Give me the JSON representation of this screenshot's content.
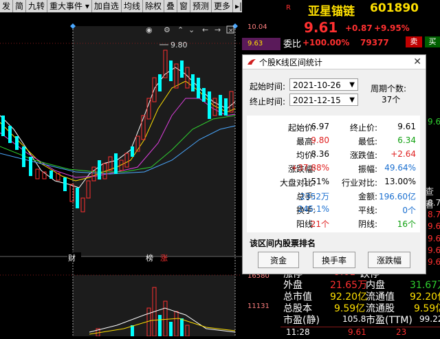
{
  "toolbar": {
    "items": [
      "发",
      "简",
      "九转",
      "重大事件",
      "加自选",
      "均线",
      "除权",
      "叠",
      "窗",
      "预测",
      "更多"
    ]
  },
  "chart": {
    "high_label": "9.80",
    "markers": [
      "财",
      "榜",
      "涨"
    ],
    "left_axis": [
      "10.04",
      "9.63",
      "16580",
      "11131"
    ]
  },
  "quote": {
    "r_label": "R",
    "stock_name": "亚星锚链",
    "stock_code": "601890",
    "price": "9.61",
    "change": "+0.87",
    "change_pct": "+9.95%",
    "weibi_label": "委比",
    "weibi_value": "+100.00%",
    "weibi_volume": "79377",
    "sell_label": "卖",
    "buy_label": "买",
    "side_values": [
      "9.6",
      "8.7",
      "8.7",
      "9.6",
      "9.6",
      "9.6",
      "9.6"
    ],
    "side_label": "查看",
    "bottom_rows": [
      {
        "l1": "涨停",
        "v1": "9.61",
        "l2": "跌停",
        "v2": ""
      },
      {
        "l1": "外盘",
        "v1": "21.65万",
        "l2": "内盘",
        "v2": "31.67万"
      },
      {
        "l1": "总市值",
        "v1": "92.20亿",
        "l2": "流通值",
        "v2": "92.20亿"
      },
      {
        "l1": "总股本",
        "v1": "9.59亿",
        "l2": "流通股",
        "v2": "9.59亿"
      },
      {
        "l1": "市盈(静)",
        "v1": "105.8",
        "l2": "市盈(TTM)",
        "v2": "99.22"
      }
    ],
    "tick_time": "11:28",
    "tick_price": "9.61",
    "tick_vol": "23"
  },
  "dialog": {
    "title": "个股K线区间统计",
    "start_label": "起始时间:",
    "start_date": "2021-10-26",
    "end_label": "终止时间:",
    "end_date": "2021-12-15",
    "period_label": "周期个数:",
    "period_value": "37个",
    "stats": [
      {
        "l": "起始价:",
        "v": "6.97",
        "c": "black",
        "l2": "终止价:",
        "v2": "9.61",
        "c2": "black"
      },
      {
        "l": "最高:",
        "v": "9.80",
        "c": "red",
        "l2": "最低:",
        "v2": "6.34",
        "c2": "green"
      },
      {
        "l": "均价:",
        "v": "8.36",
        "c": "black",
        "l2": "涨跌值:",
        "v2": "+2.64",
        "c2": "red"
      },
      {
        "l": "涨跌幅:",
        "v": "+37.88%",
        "c": "red",
        "l2": "振幅:",
        "v2": "49.64%",
        "c2": "blue"
      },
      {
        "l": "大盘对比:",
        "v": "1.51%",
        "c": "black",
        "l2": "行业对比:",
        "v2": "13.00%",
        "c2": "black"
      },
      {
        "l": "总手:",
        "v": "2352万",
        "c": "blue",
        "l2": "金额:",
        "v2": "196.60亿",
        "c2": "blue"
      },
      {
        "l": "换手:",
        "v": "245.1%",
        "c": "blue",
        "l2": "平线:",
        "v2": "0个",
        "c2": "blue"
      },
      {
        "l": "阳线:",
        "v": "21个",
        "c": "red",
        "l2": "阴线:",
        "v2": "16个",
        "c2": "green"
      }
    ],
    "ranking_title": "该区间内股票排名",
    "btn_funds": "资金",
    "btn_turnover": "换手率",
    "btn_change": "涨跌幅"
  }
}
